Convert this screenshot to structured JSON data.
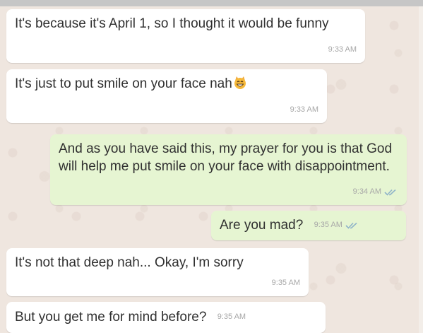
{
  "chat": {
    "messages": [
      {
        "direction": "incoming",
        "text": "It's because it's April 1, so I thought it would be funny",
        "time": "9:33 AM"
      },
      {
        "direction": "incoming",
        "text": "It's just to put smile on your face nah",
        "emoji": "grinning-cat-icon",
        "time": "9:33 AM"
      },
      {
        "direction": "outgoing",
        "text": "And as you have said this, my prayer for you is that God will help me put smile on your face with disappointment.",
        "time": "9:34 AM",
        "status": "read"
      },
      {
        "direction": "outgoing",
        "text": "Are you mad?",
        "time": "9:35 AM",
        "status": "read"
      },
      {
        "direction": "incoming",
        "text": "It's not that deep nah... Okay, I'm sorry",
        "time": "9:35 AM"
      },
      {
        "direction": "incoming",
        "text": "But you get me for mind before?",
        "time": "9:35 AM"
      }
    ]
  },
  "colors": {
    "chat_background": "#efe6df",
    "incoming_bubble": "#ffffff",
    "outgoing_bubble": "#e6f5d2",
    "read_ticks": "#8fb3c9",
    "timestamp": "#a7a7a7"
  }
}
